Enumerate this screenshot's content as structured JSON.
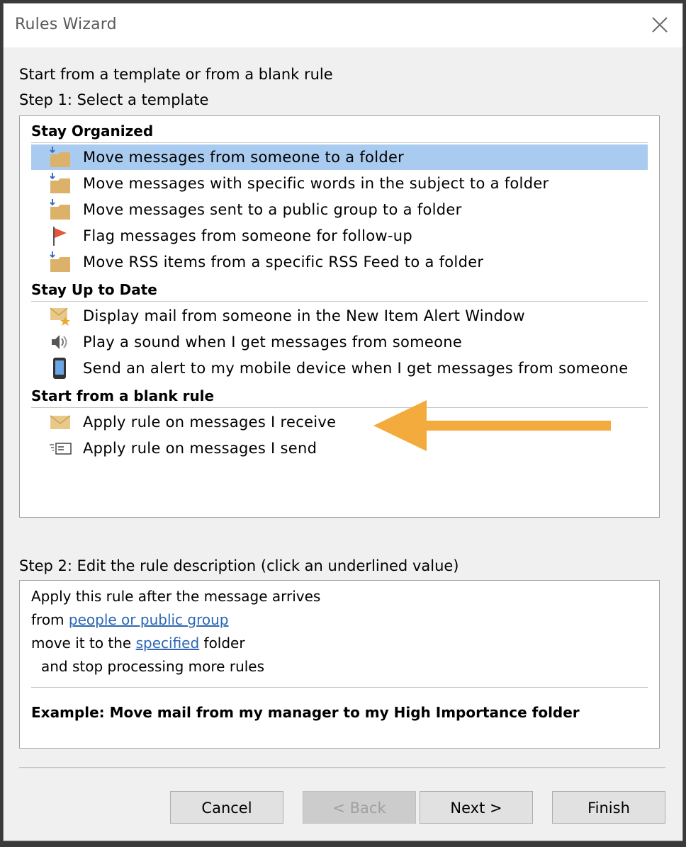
{
  "window": {
    "title": "Rules Wizard"
  },
  "intro": {
    "line1": "Start from a template or from a blank rule",
    "line2": "Step 1: Select a template"
  },
  "templates": {
    "groups": [
      {
        "header": "Stay Organized",
        "items": [
          {
            "label": "Move messages from someone to a folder",
            "icon": "move-to-folder-icon",
            "selected": true
          },
          {
            "label": "Move messages with specific words in the subject to a folder",
            "icon": "move-to-folder-icon"
          },
          {
            "label": "Move messages sent to a public group to a folder",
            "icon": "move-to-folder-icon"
          },
          {
            "label": "Flag messages from someone for follow-up",
            "icon": "flag-icon"
          },
          {
            "label": "Move RSS items from a specific RSS Feed to a folder",
            "icon": "move-to-folder-icon"
          }
        ]
      },
      {
        "header": "Stay Up to Date",
        "items": [
          {
            "label": "Display mail from someone in the New Item Alert Window",
            "icon": "new-mail-alert-icon"
          },
          {
            "label": "Play a sound when I get messages from someone",
            "icon": "speaker-icon"
          },
          {
            "label": "Send an alert to my mobile device when I get messages from someone",
            "icon": "mobile-device-icon"
          }
        ]
      },
      {
        "header": "Start from a blank rule",
        "items": [
          {
            "label": "Apply rule on messages I receive",
            "icon": "envelope-icon"
          },
          {
            "label": "Apply rule on messages I send",
            "icon": "send-mail-icon"
          }
        ]
      }
    ]
  },
  "step2": {
    "label": "Step 2: Edit the rule description (click an underlined value)",
    "line1": "Apply this rule after the message arrives",
    "line2_prefix": "from ",
    "line2_link": "people or public group",
    "line3_prefix": "move it to the ",
    "line3_link": "specified",
    "line3_suffix": " folder",
    "line4": "and stop processing more rules",
    "example": "Example: Move mail from my manager to my High Importance folder"
  },
  "buttons": {
    "cancel": "Cancel",
    "back": "< Back",
    "next": "Next >",
    "finish": "Finish"
  },
  "colors": {
    "selection": "#a9cbef",
    "link": "#2b67b4",
    "annotation_arrow": "#f2ab3c",
    "folder": "#dcb26a",
    "flag": "#e4573a"
  }
}
